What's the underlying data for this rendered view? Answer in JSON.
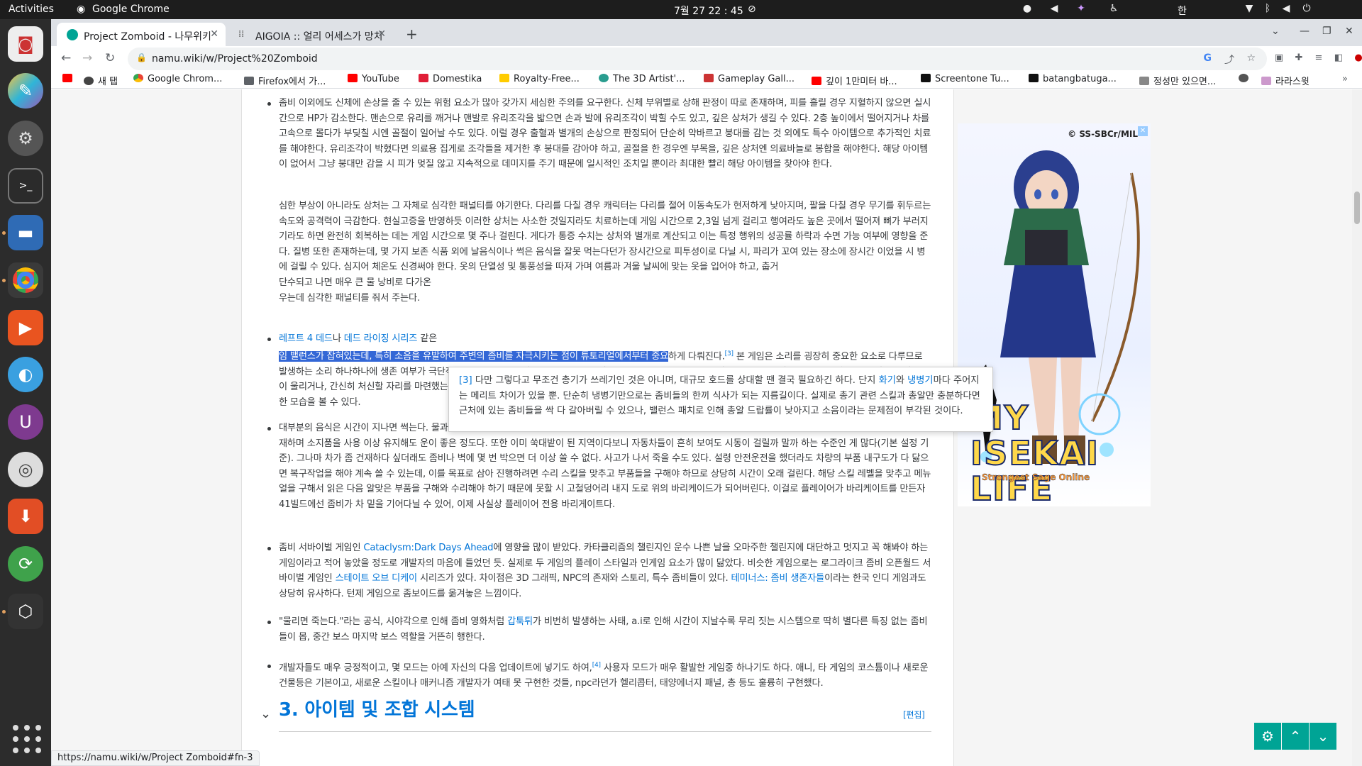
{
  "topbar": {
    "activities": "Activities",
    "app_name": "Google Chrome",
    "clock": "7월 27  22 : 45",
    "ime": "한"
  },
  "tabs": [
    {
      "title": "Project Zomboid - 나무위키",
      "active": true
    },
    {
      "title": "AIGOIA :: 얼리 어세스가 망치",
      "active": false
    }
  ],
  "address_bar": {
    "url": "namu.wiki/w/Project%20Zomboid"
  },
  "bookmarks": [
    {
      "label": "",
      "icon": "youtube-icon"
    },
    {
      "label": "새 탭",
      "icon": "globe-icon"
    },
    {
      "label": "Google Chrom...",
      "icon": "chrome-icon"
    },
    {
      "label": "Firefox에서 가...",
      "icon": "folder-icon"
    },
    {
      "label": "YouTube",
      "icon": "youtube-icon"
    },
    {
      "label": "Domestika",
      "icon": "domestika-icon"
    },
    {
      "label": "Royalty-Free...",
      "icon": "warning-icon"
    },
    {
      "label": "The 3D Artist'...",
      "icon": "globe-icon"
    },
    {
      "label": "Gameplay Gall...",
      "icon": "flag-icon"
    },
    {
      "label": "깊이 1만미터 바...",
      "icon": "youtube-icon"
    },
    {
      "label": "Screentone Tu...",
      "icon": "screentone-icon"
    },
    {
      "label": "batangbatuga...",
      "icon": "screentone-icon"
    },
    {
      "label": "정성만 있으면...",
      "icon": "dots-icon"
    },
    {
      "label": "",
      "icon": "globe-icon"
    },
    {
      "label": "라라스윗",
      "icon": "lara-icon"
    }
  ],
  "article": {
    "p1": {
      "text": "좀비 이외에도 신체에 손상을 줄 수 있는 위험 요소가 많아 갖가지 세심한 주의를 요구한다. 신체 부위별로 상해 판정이 따로 존재하며, 피를 흘릴 경우 지혈하지 않으면 실시간으로 HP가 감소한다. 맨손으로 유리를 깨거나 맨발로 유리조각을 밟으면 손과 발에 유리조각이 박힐 수도 있고, 깊은 상처가 생길 수 있다. 2층 높이에서 떨어지거나 차를 고속으로 몰다가 부딪칠 시엔 골절이 일어날 수도 있다. 이럴 경우 출혈과 별개의 손상으로 판정되어 단순히 약바르고 붕대를 감는 것 외에도 특수 아이템으로 추가적인 치료를 해야한다. 유리조각이 박혔다면 의료용 집게로 조각들을 제거한 후 붕대를 감아야 하고, 골절을 한 경우엔 부목을, 깊은 상처엔 의료바늘로 봉합을 해야한다. 해당 아이템이 없어서 그냥 붕대만 감을 시 피가 멎질 않고 지속적으로 데미지를 주기 때문에 일시적인 조치일 뿐이라 최대한 빨리 해당 아이템을 찾아야 한다."
    },
    "p2": {
      "text": "심한 부상이 아니라도 상처는 그 자체로 심각한 패널티를 야기한다. 다리를 다칠 경우 캐릭터는 다리를 절어 이동속도가 현저하게 낮아지며, 팔을 다칠 경우 무기를 휘두르는 속도와 공격력이 극감한다. 현실고증을 반영하듯 이러한 상처는 사소한 것일지라도 치료하는데 게임 시간으로 2,3일 넘게 걸리고 행여라도 높은 곳에서 떨어져 뼈가 부러지기라도 하면 완전히 회복하는 데는 게임 시간으로 몇 주나 걸린다. 게다가 통증 수치는 상처와 별개로 계산되고 이는 특정 행위의 성공률 하락과 수면 가능 여부에 영향을 준다. 질병 또한 존재하는데, 몇 가지 보존 식품 외에 날음식이나 썩은 음식을 잘못 먹는다던가 장시간으로 피투성이로 다닐 시, 파리가 꼬여 있는 장소에 장시간 이었을 시 병에 걸릴 수 있다. 심지어 체온도 신경써야 한다. 옷의 단열성 및 통풍성을 따져 가며 여름과 겨울 날씨에 맞는 옷을 입어야 하고, 춥거",
      "line7": "단수되고 나면 매우 큰 물 낭비로 다가온",
      "line8": "우는데 심각한 패널티를 줘서 주는다."
    },
    "p3": {
      "link1": "레프트 4 데드",
      "conj1": "나 ",
      "link2": "데드 라이징 시리즈",
      "cont1": " 같은",
      "selected": "임 밸런스가 잡혀있는데, 특히 소음을 유발하여 주변의 좀비를 자극시키는 점이 튜토리얼에서부터 중요",
      "after_sel": "하게 다뤄진다.",
      "sup": "[3]",
      "rest": " 본 게임은 소리를 굉장히 중요한 요소로 다루므로 발생하는 소리 하나하나에 생존 여부가 극단적으로 갈린다. 아이템을 얻으려고 남의 집에 들어왔는데 방범벨이 울리거나, 먼 곳으로 가겠다고 차를 하나 골라 탔더니 경보음이 울리거나, 간신히 처신할 자리를 마련했는데 뜬금없이 헬기의 굉음이 사방에 울려 퍼지는 등. 평소의 생활에 편의성과 치안을 보장했던 요소가 생존에 방해되는 아이러니한 모습을 볼 수 있다."
    },
    "p4": {
      "text": "대부분의 음식은 시간이 지나면 썩는다. 물과 전기는 길면 수 개월, 짧으면 내일이라도 끊길 수 있으며 도구는 내구도가 존재하여 영구적으로 사용할 수 없다. 무게 제한도 존재하며 소지품을 사용 이상 유지해도 운이 좋은 정도다. 또한 이미 쑥대밭이 된 지역이다보니 자동차들이 흔히 보여도 시동이 걸릴까 말까 하는 수준인 게 많다(기본 설정 기준). 그나마 차가 좀 건재하다 싶더래도 좀비나 벽에 몇 번 박으면 더 이상 쓸 수 없다. 사고가 나서 죽을 수도 있다. 설령 안전운전을 했더라도 차량의 부품 내구도가 다 닳으면 복구작업을 해야 계속 쓸 수 있는데, 이를 목표로 삼아 진행하려면 수리 스킬을 맞추고 부품들을 구해야 하므로 상당히 시간이 오래 걸린다. 해당 스킬 레벨을 맞추고 메뉴얼을 구해서 읽은 다음 알맞은 부품을 구해와 수리해야 하기 때문에 못할 시 고철덩어리 내지 도로 위의 바리케이드가 되어버린다. 이걸로 플레이어가 바리케이트를 만든자 41빌드에선 좀비가 차 밑을 기어다닐 수 있어, 이제 사실상 플레이어 전용 바리게이트다."
    },
    "p5": {
      "pre": "좀비 서바이벌 게임인 ",
      "link1": "Cataclysm:Dark Days Ahead",
      "mid1": "에 영향을 많이 받았다. 카타클리즘의 챌린지인 운수 나쁜 날을 오마주한 챌린지에 대단하고 멋지고 꼭 해봐야 하는 게임이라고 적어 놓았을 정도로 개발자의 마음에 들었던 듯. 실제로 두 게임의 플레이 스타일과 인게임 요소가 많이 닮았다. 비슷한 게임으로는 로그라이크 좀비 오픈월드 서바이벌 게임인 ",
      "link2": "스테이트 오브 디케이",
      "mid2": " 시리즈가 있다. 차이점은 3D 그래픽, NPC의 존재와 스토리, 특수 좀비들이 있다. ",
      "link3": "테미너스: 좀비 생존자들",
      "post": "이라는 한국 인디 게임과도 상당히 유사하다. 턴제 게임으로 좀보이드를 옮겨놓은 느낌이다."
    },
    "p6": {
      "pre": "\"물리면 죽는다.\"라는 공식, 시야각으로 인해 좀비 영화처럼 ",
      "link1": "갑툭튀",
      "post": "가 비번히 발생하는 사태, a.i로 인해 시간이 지날수록 무리 짓는 시스템으로 딱히 별다른 특징 없는 좀비들이 몹, 중간 보스 마지막 보스 역할을 거뜬히 행한다."
    },
    "p7": {
      "pre": "개발자들도 매우 긍정적이고, 몇 모드는 아예 자신의 다음 업데이트에 넣기도 하여,",
      "sup": "[4]",
      "post": " 사용자 모드가 매우 활발한 게임중 하나기도 하다. 애니, 타 게임의 코스튬이나 새로운 건물등은 기본이고, 새로운 스킬이나 매커니즘 개발자가 여태 못 구현한 것들, npc라던가 헬리콥터, 태양에너지 패널, 총 등도 훌륭히 구현했다."
    },
    "section_heading": "3. 아이템 및 조합 시스템",
    "edit_link": "[편집]"
  },
  "footnote": {
    "ref": "[3]",
    "pre": " 다만 그렇다고 무조건 총기가 쓰레기인 것은 아니며, 대규모 호드를 상대할 땐 결국 필요하긴 하다. 단지 ",
    "link1": "화기",
    "conj": "와 ",
    "link2": "냉병기",
    "post": "마다 주어지는 메리트 차이가 있을 뿐. 단순히 냉병기만으로는 좀비들의 한끼 식사가 되는 지름길이다. 실제로 총기 관련 스킬과 총알만 충분하다면 근처에 있는 좀비들을 싹 다 갈아버릴 수 있으나, 밸런스 패치로 인해 총알 드랍률이 낮아지고 소음이라는 문제점이 부각된 것이다."
  },
  "ad": {
    "copyright": "© SS-SBCr/MIL",
    "title": "MY ISEKAI LIFE",
    "subtitle": "Strongest Sage Online"
  },
  "status_bar": {
    "hover_url": "https://namu.wiki/w/Project Zomboid#fn-3"
  },
  "colors": {
    "link": "#0275d8",
    "selection": "#3367d6",
    "float_button": "#00a495"
  }
}
